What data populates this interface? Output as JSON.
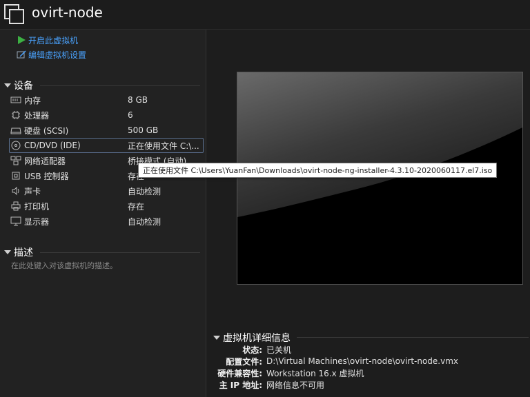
{
  "window": {
    "title": "ovirt-node"
  },
  "actions": {
    "power_on": "开启此虚拟机",
    "edit_settings": "编辑虚拟机设置"
  },
  "devices": {
    "header": "设备",
    "items": [
      {
        "icon": "memory-icon",
        "name": "内存",
        "value": "8 GB"
      },
      {
        "icon": "processor-icon",
        "name": "处理器",
        "value": "6"
      },
      {
        "icon": "harddisk-icon",
        "name": "硬盘 (SCSI)",
        "value": "500 GB"
      },
      {
        "icon": "cd-dvd-icon",
        "name": "CD/DVD (IDE)",
        "value": "正在使用文件 C:\\..."
      },
      {
        "icon": "network-adapter-icon",
        "name": "网络适配器",
        "value": "桥接模式 (自动)"
      },
      {
        "icon": "usb-controller-icon",
        "name": "USB 控制器",
        "value": "存在"
      },
      {
        "icon": "sound-card-icon",
        "name": "声卡",
        "value": "自动检测"
      },
      {
        "icon": "printer-icon",
        "name": "打印机",
        "value": "存在"
      },
      {
        "icon": "display-icon",
        "name": "显示器",
        "value": "自动检测"
      }
    ]
  },
  "description": {
    "header": "描述",
    "placeholder": "在此处键入对该虚拟机的描述。"
  },
  "tooltip": "正在使用文件 C:\\Users\\YuanFan\\Downloads\\ovirt-node-ng-installer-4.3.10-2020060117.el7.iso",
  "details": {
    "header": "虚拟机详细信息",
    "rows": [
      {
        "key": "状态:",
        "value": "已关机"
      },
      {
        "key": "配置文件:",
        "value": "D:\\Virtual Machines\\ovirt-node\\ovirt-node.vmx"
      },
      {
        "key": "硬件兼容性:",
        "value": "Workstation 16.x 虚拟机"
      },
      {
        "key": "主 IP 地址:",
        "value": "网络信息不可用"
      }
    ]
  },
  "colors": {
    "link": "#4aa3ff",
    "play": "#3cb043",
    "background": "#1f1f1f"
  }
}
